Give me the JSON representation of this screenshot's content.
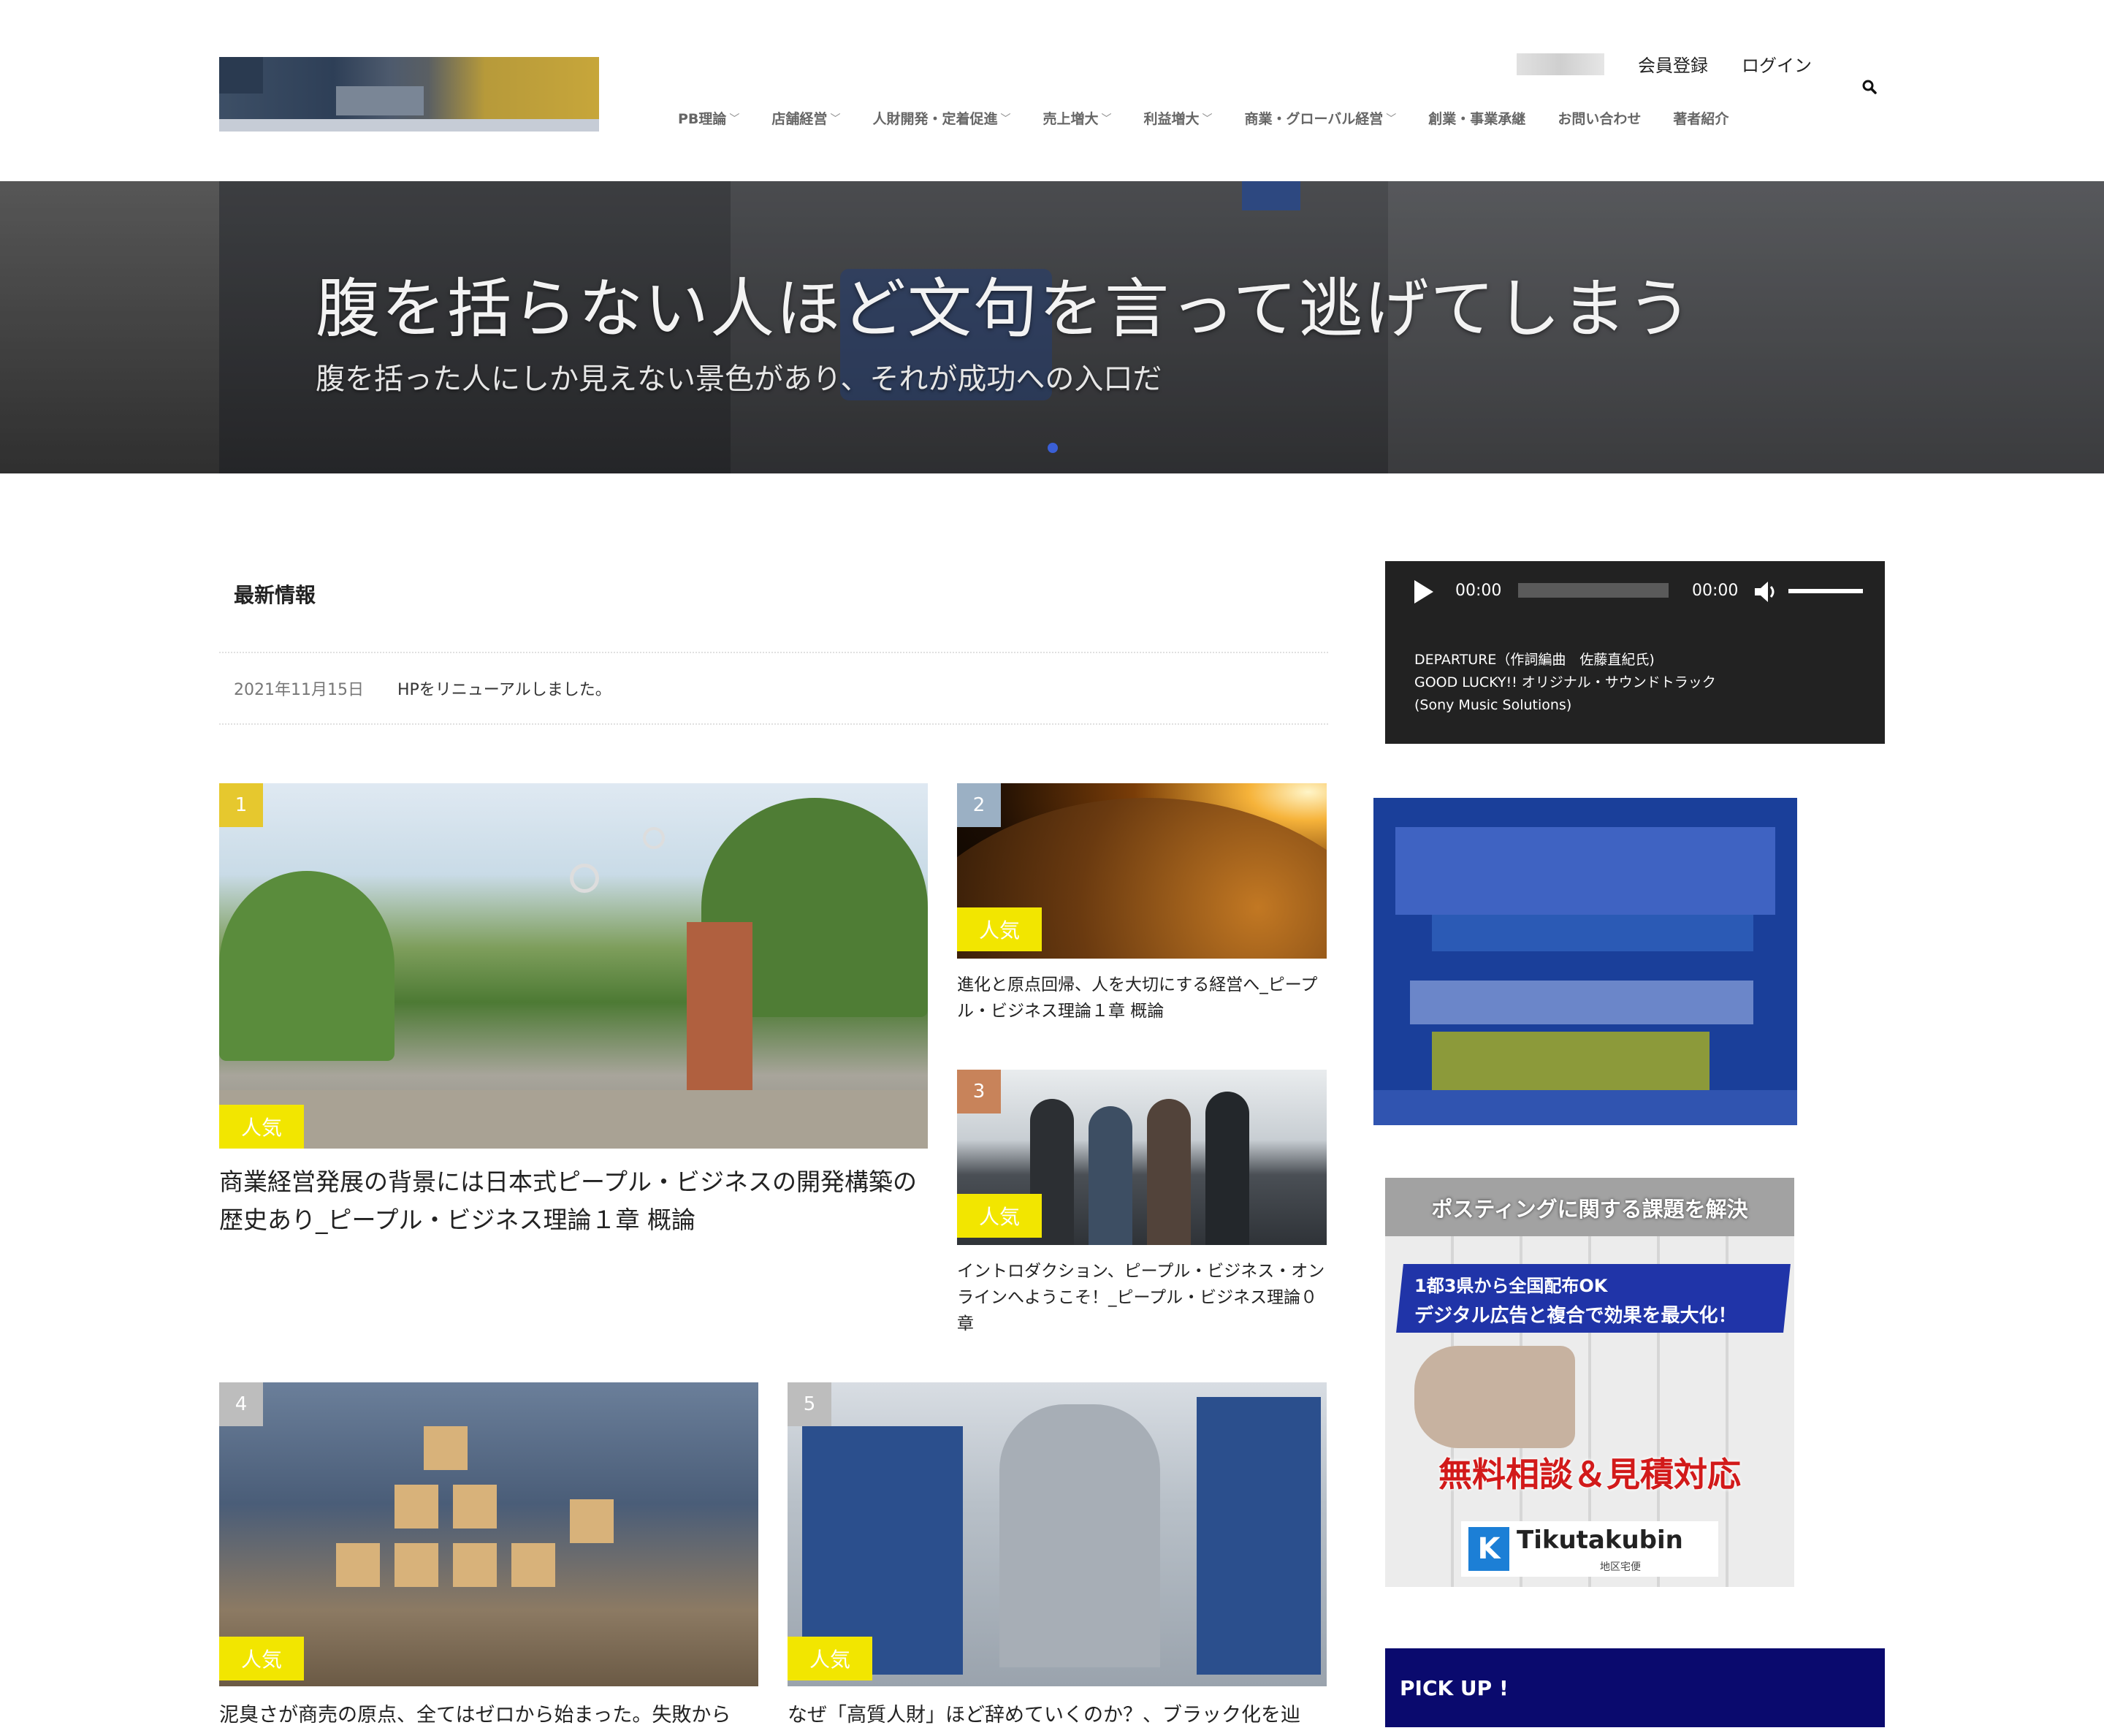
{
  "header": {
    "signup": "会員登録",
    "login": "ログイン",
    "nav": [
      {
        "label": "PB理論",
        "dropdown": true
      },
      {
        "label": "店舗経営",
        "dropdown": true
      },
      {
        "label": "人財開発・定着促進",
        "dropdown": true
      },
      {
        "label": "売上増大",
        "dropdown": true
      },
      {
        "label": "利益増大",
        "dropdown": true
      },
      {
        "label": "商業・グローバル経営",
        "dropdown": true
      },
      {
        "label": "創業・事業承継",
        "dropdown": false
      },
      {
        "label": "お問い合わせ",
        "dropdown": false
      },
      {
        "label": "著者紹介",
        "dropdown": false
      }
    ]
  },
  "hero": {
    "title": "腹を括らない人ほど文句を言って逃げてしまう",
    "subtitle": "腹を括った人にしか見えない景色があり、それが成功への入口だ"
  },
  "news": {
    "heading": "最新情報",
    "items": [
      {
        "date": "2021年11月15日",
        "text": "HPをリニューアルしました。"
      }
    ]
  },
  "cards": [
    {
      "rank": "1",
      "badge": "人気",
      "rank_color": "#e6c82e",
      "title": "商業経営発展の背景には日本式ピープル・ビジネスの開発構築の歴史あり_ピープル・ビジネス理論１章 概論"
    },
    {
      "rank": "2",
      "badge": "人気",
      "rank_color": "#9bb0c4",
      "title": "進化と原点回帰、人を大切にする経営へ_ピープル・ビジネス理論１章 概論"
    },
    {
      "rank": "3",
      "badge": "人気",
      "rank_color": "#c8835a",
      "title": "イントロダクション、ピープル・ビジネス・オンラインへようこそ！_ピープル・ビジネス理論０章"
    },
    {
      "rank": "4",
      "badge": "人気",
      "rank_color": "#bdbdbd",
      "title": "泥臭さが商売の原点、全てはゼロから始まった。失敗から"
    },
    {
      "rank": "5",
      "badge": "人気",
      "rank_color": "#bdbdbd",
      "title": "なぜ「高質人財」ほど辞めていくのか？、ブラック化を辿"
    }
  ],
  "player": {
    "current_time": "00:00",
    "duration": "00:00",
    "caption_line1": "DEPARTURE（作詞編曲　佐藤直紀氏)",
    "caption_line2": "GOOD LUCKY!! オリジナル・サウンドトラック",
    "caption_line3": "(Sony Music Solutions)"
  },
  "ad2": {
    "headline": "ポスティングに関する課題を解決",
    "line1": "1都3県から全国配布OK",
    "line2": "デジタル広告と複合で効果を最大化！",
    "cta": "無料相談＆見積対応",
    "brand": "Tikutakubin",
    "brand_sub": "地区宅便",
    "brand_logo": "K"
  },
  "sidebar": {
    "pickup": "PICK UP !"
  }
}
